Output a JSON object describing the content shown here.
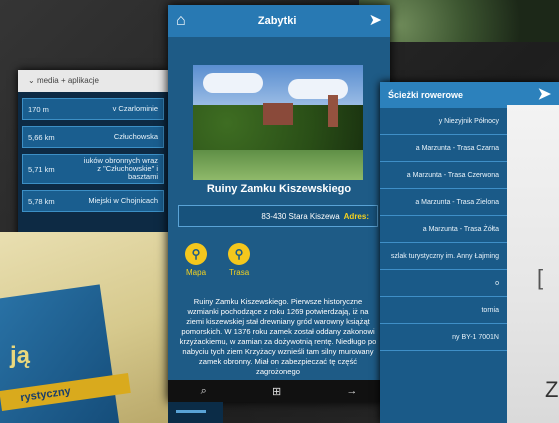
{
  "left_phone": {
    "bar_text": "media + aplikacje",
    "rows": [
      {
        "name": "v Czarlominie",
        "dist": "170 m"
      },
      {
        "name": "Człuchowska",
        "dist": "5,66 km"
      },
      {
        "name": "iuków obronnych wraz z \"Człuchowskie\" i basztami",
        "dist": "5,71 km"
      },
      {
        "name": "Miejski w Chojnicach",
        "dist": "5,78 km"
      }
    ]
  },
  "book": {
    "title_fragment": "ją",
    "ribbon": "rystyczny"
  },
  "center_phone": {
    "header_title": "Zabytki",
    "place_title": "Ruiny Zamku Kiszewskiego",
    "address_label": "Adres:",
    "address_value": "83-430 Stara Kiszewa",
    "actions": [
      {
        "label": "Trasa"
      },
      {
        "label": "Mapa"
      }
    ],
    "description": "Ruiny Zamku Kiszewskiego. Pierwsze historyczne wzmianki pochodzące z roku 1269 potwierdzają, iż na ziemi kiszewskiej stał drewniany gród warowny książąt pomorskich. W 1376 roku zamek został oddany zakonowi krzyżackiemu, w zamian za dożywotnią rentę. Niedługo po nabyciu tych ziem Krzyżacy wznieśli tam silny murowany zamek obronny. Miał on zabezpieczać tę część zagrożonego"
  },
  "right_phone": {
    "header_title": "Ścieżki rowerowe",
    "items": [
      "y Niezyjnik Północy",
      "a Marzunta - Trasa Czarna",
      "a Marzunta - Trasa Czerwona",
      "a Marzunta - Trasa Zielona",
      "a Marzunta - Trasa Żółta",
      "szlak turystyczny im. Anny Łajming",
      "o",
      "tornia",
      "ny BY-1 7001N"
    ]
  },
  "map_photo": {
    "letters": [
      "Z"
    ]
  }
}
